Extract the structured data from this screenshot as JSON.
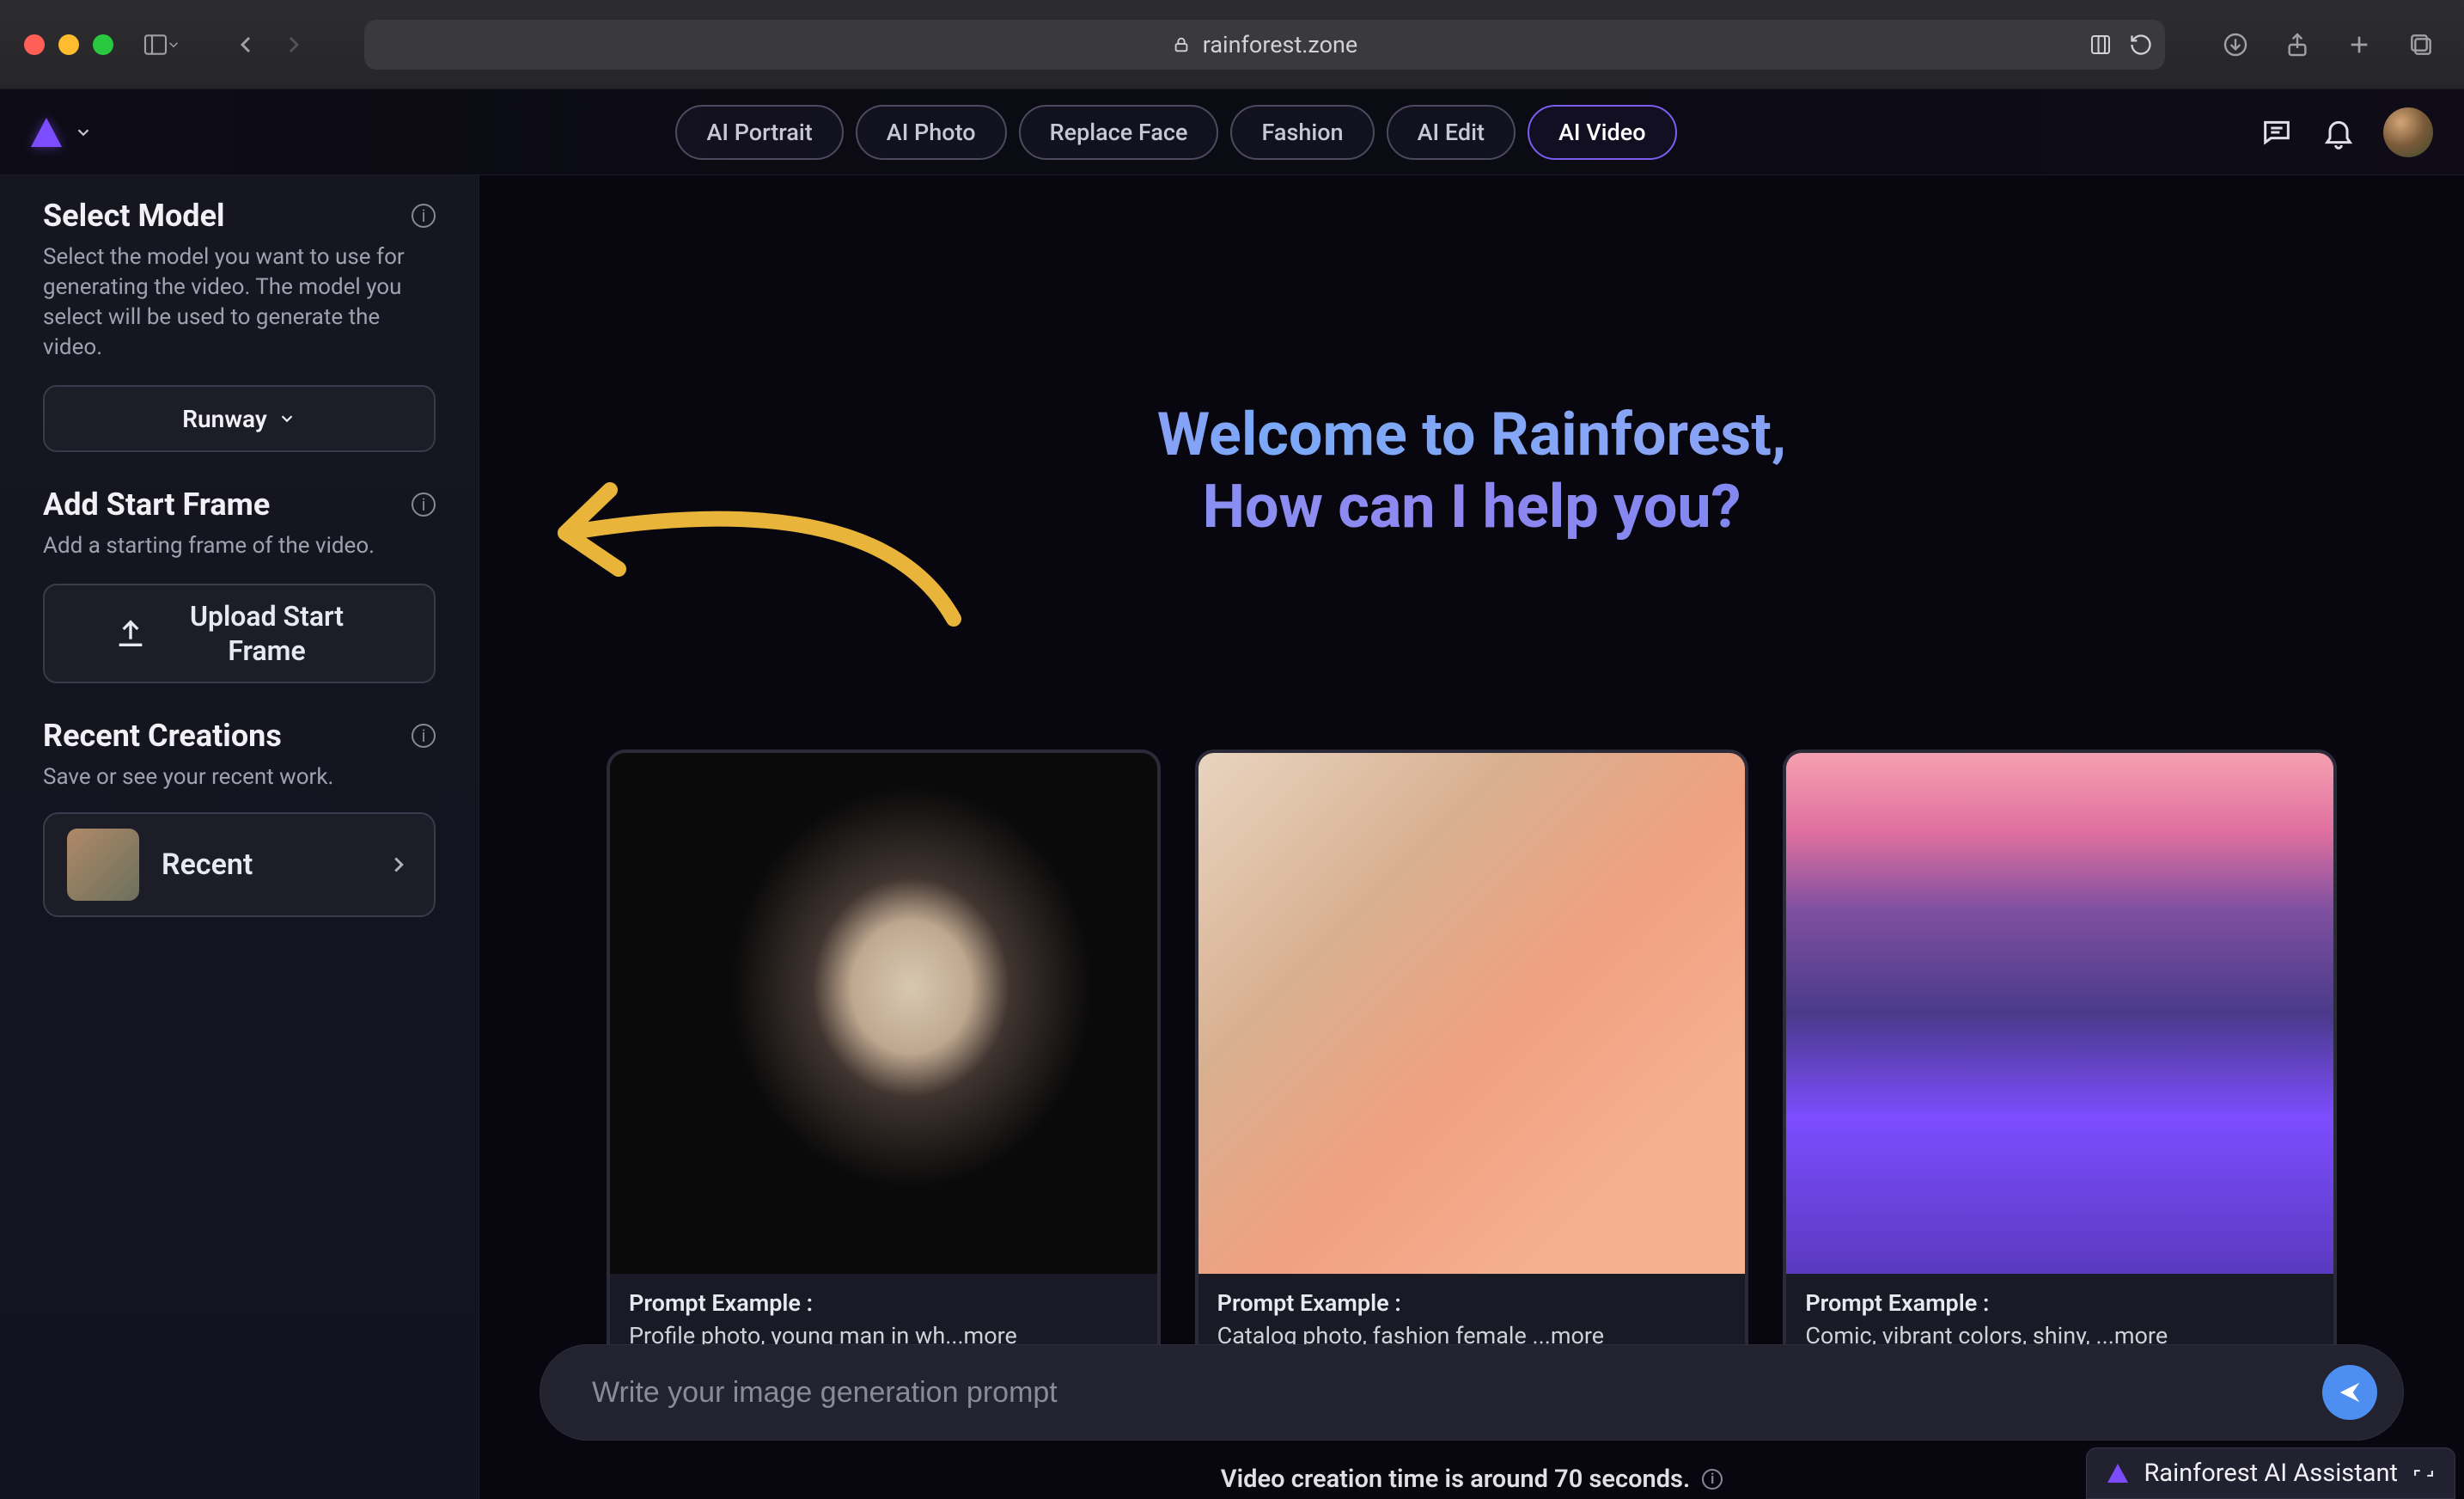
{
  "browser": {
    "url_host": "rainforest.zone"
  },
  "header": {
    "tabs": [
      "AI Portrait",
      "AI Photo",
      "Replace Face",
      "Fashion",
      "AI Edit",
      "AI Video"
    ],
    "active_tab_index": 5
  },
  "sidebar": {
    "select_model": {
      "title": "Select Model",
      "desc": "Select the model you want to use for generating the video. The model you select will be used to generate the video.",
      "value": "Runway"
    },
    "start_frame": {
      "title": "Add Start Frame",
      "desc": "Add a starting frame of the video.",
      "button": "Upload Start Frame"
    },
    "recent": {
      "title": "Recent Creations",
      "desc": "Save or see your recent work.",
      "button": "Recent"
    }
  },
  "main": {
    "welcome_line1": "Welcome to Rainforest,",
    "welcome_line2": "How can I help you?",
    "cards": [
      {
        "title": "Prompt Example :",
        "text": "Profile photo, young man in wh...more"
      },
      {
        "title": "Prompt Example :",
        "text": "Catalog photo, fashion female ...more"
      },
      {
        "title": "Prompt Example :",
        "text": "Comic, vibrant colors, shiny, ...more"
      }
    ],
    "prompt_placeholder": "Write your image generation prompt",
    "status": "Video creation time is around 70 seconds."
  },
  "assistant": {
    "label": "Rainforest AI Assistant"
  }
}
